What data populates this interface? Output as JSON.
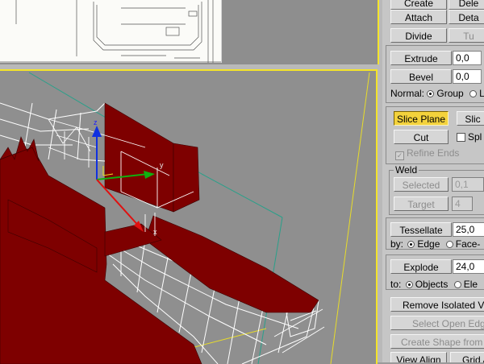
{
  "panel": {
    "top_buttons": {
      "create": "Create",
      "delete": "Dele",
      "attach": "Attach",
      "detach": "Deta",
      "divide": "Divide",
      "turn": "Tu"
    },
    "extrude": {
      "label": "Extrude",
      "value": "0,0"
    },
    "bevel": {
      "label": "Bevel",
      "value": "0,0"
    },
    "normal": {
      "label": "Normal:",
      "group": "Group",
      "local": "L"
    },
    "slice_plane": "Slice Plane",
    "slice": "Slic",
    "cut": "Cut",
    "split": "Spl",
    "refine_ends": "Refine Ends",
    "weld": {
      "title": "Weld",
      "selected_label": "Selected",
      "selected_value": "0,1",
      "target_label": "Target",
      "target_value": "4"
    },
    "tessellate": {
      "label": "Tessellate",
      "value": "25,0",
      "by_label": "by:",
      "edge": "Edge",
      "face": "Face-"
    },
    "explode": {
      "label": "Explode",
      "value": "24,0",
      "to_label": "to:",
      "objects": "Objects",
      "elements": "Ele"
    },
    "remove_isolated": "Remove Isolated Vert",
    "select_open_edges": "Select Open Edges",
    "create_shape": "Create Shape from Ed",
    "view_align": "View Align",
    "grid_align": "Grid A"
  },
  "viewport": {
    "axis_x": "x",
    "axis_y": "y",
    "axis_z": "z"
  },
  "colors": {
    "mesh_faces": "#7e0000",
    "wireframe": "#ffffff",
    "active_border": "#f4e42a",
    "slice_button": "#f3d23c"
  }
}
